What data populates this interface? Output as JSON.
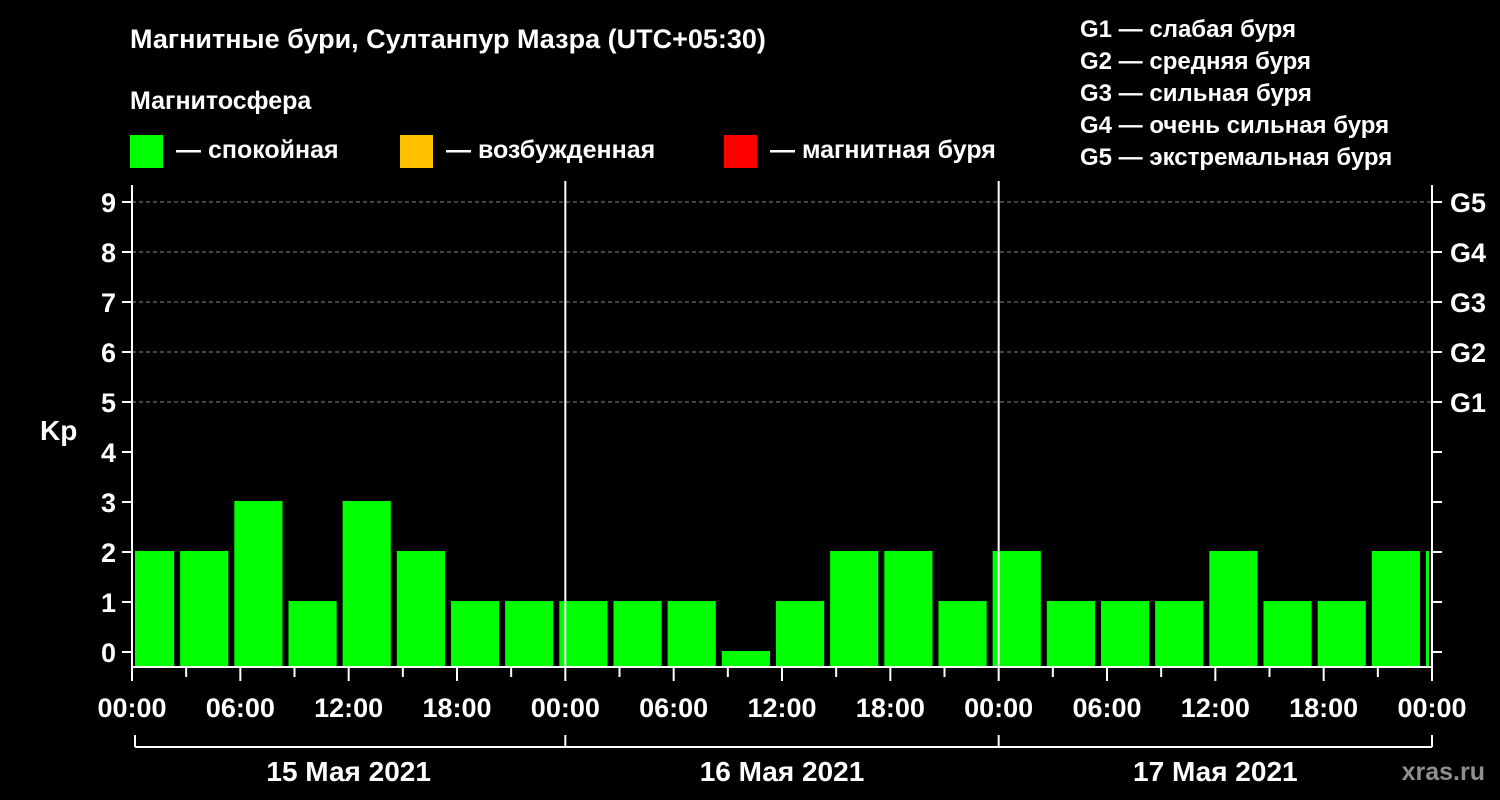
{
  "chart_data": {
    "type": "bar",
    "title": "Магнитные бури, Султанпур Мазра (UTC+05:30)",
    "subtitle": "Магнитосфера",
    "ylabel": "Kp",
    "xlabel": "",
    "ylim": [
      0,
      9
    ],
    "yticks": [
      "0",
      "1",
      "2",
      "3",
      "4",
      "5",
      "6",
      "7",
      "8",
      "9"
    ],
    "grid": true,
    "legend_position": "top",
    "storm_scale": [
      {
        "kp": 5,
        "label": "G1"
      },
      {
        "kp": 6,
        "label": "G2"
      },
      {
        "kp": 7,
        "label": "G3"
      },
      {
        "kp": 8,
        "label": "G4"
      },
      {
        "kp": 9,
        "label": "G5"
      }
    ],
    "x_start": "2021-05-15 00:00",
    "x_end": "2021-05-18 00:00",
    "x_tick_labels": [
      "00:00",
      "06:00",
      "12:00",
      "18:00",
      "00:00",
      "06:00",
      "12:00",
      "18:00",
      "00:00",
      "06:00",
      "12:00",
      "18:00",
      "00:00"
    ],
    "day_labels": [
      "15 Мая 2021",
      "16 Мая 2021",
      "17 Мая 2021"
    ],
    "series": [
      {
        "values": [
          {
            "start": "2021-05-15 00:00",
            "end": "2021-05-15 02:30",
            "kp": 2
          },
          {
            "start": "2021-05-15 02:30",
            "end": "2021-05-15 05:30",
            "kp": 2
          },
          {
            "start": "2021-05-15 05:30",
            "end": "2021-05-15 08:30",
            "kp": 3
          },
          {
            "start": "2021-05-15 08:30",
            "end": "2021-05-15 11:30",
            "kp": 1
          },
          {
            "start": "2021-05-15 11:30",
            "end": "2021-05-15 14:30",
            "kp": 3
          },
          {
            "start": "2021-05-15 14:30",
            "end": "2021-05-15 17:30",
            "kp": 2
          },
          {
            "start": "2021-05-15 17:30",
            "end": "2021-05-15 20:30",
            "kp": 1
          },
          {
            "start": "2021-05-15 20:30",
            "end": "2021-05-15 23:30",
            "kp": 1
          },
          {
            "start": "2021-05-15 23:30",
            "end": "2021-05-16 02:30",
            "kp": 1
          },
          {
            "start": "2021-05-16 02:30",
            "end": "2021-05-16 05:30",
            "kp": 1
          },
          {
            "start": "2021-05-16 05:30",
            "end": "2021-05-16 08:30",
            "kp": 1
          },
          {
            "start": "2021-05-16 08:30",
            "end": "2021-05-16 11:30",
            "kp": 0
          },
          {
            "start": "2021-05-16 11:30",
            "end": "2021-05-16 14:30",
            "kp": 1
          },
          {
            "start": "2021-05-16 14:30",
            "end": "2021-05-16 17:30",
            "kp": 2
          },
          {
            "start": "2021-05-16 17:30",
            "end": "2021-05-16 20:30",
            "kp": 2
          },
          {
            "start": "2021-05-16 20:30",
            "end": "2021-05-16 23:30",
            "kp": 1
          },
          {
            "start": "2021-05-16 23:30",
            "end": "2021-05-17 02:30",
            "kp": 2
          },
          {
            "start": "2021-05-17 02:30",
            "end": "2021-05-17 05:30",
            "kp": 1
          },
          {
            "start": "2021-05-17 05:30",
            "end": "2021-05-17 08:30",
            "kp": 1
          },
          {
            "start": "2021-05-17 08:30",
            "end": "2021-05-17 11:30",
            "kp": 1
          },
          {
            "start": "2021-05-17 11:30",
            "end": "2021-05-17 14:30",
            "kp": 2
          },
          {
            "start": "2021-05-17 14:30",
            "end": "2021-05-17 17:30",
            "kp": 1
          },
          {
            "start": "2021-05-17 17:30",
            "end": "2021-05-17 20:30",
            "kp": 1
          },
          {
            "start": "2021-05-17 20:30",
            "end": "2021-05-17 23:30",
            "kp": 2
          },
          {
            "start": "2021-05-17 23:30",
            "end": "2021-05-18 00:00",
            "kp": 2
          }
        ]
      }
    ]
  },
  "legend": {
    "items": [
      {
        "label": "— спокойная",
        "color": "#00ff00"
      },
      {
        "label": "— возбужденная",
        "color": "#ffc000"
      },
      {
        "label": "— магнитная буря",
        "color": "#ff0000"
      }
    ]
  },
  "scale_legend": [
    "G1 — слабая буря",
    "G2 — средняя буря",
    "G3 — сильная буря",
    "G4 — очень сильная буря",
    "G5 — экстремальная буря"
  ],
  "watermark": "xras.ru",
  "colors": {
    "background": "#000000",
    "text": "#ffffff",
    "quiet": "#00ff00",
    "grid": "#888888"
  }
}
